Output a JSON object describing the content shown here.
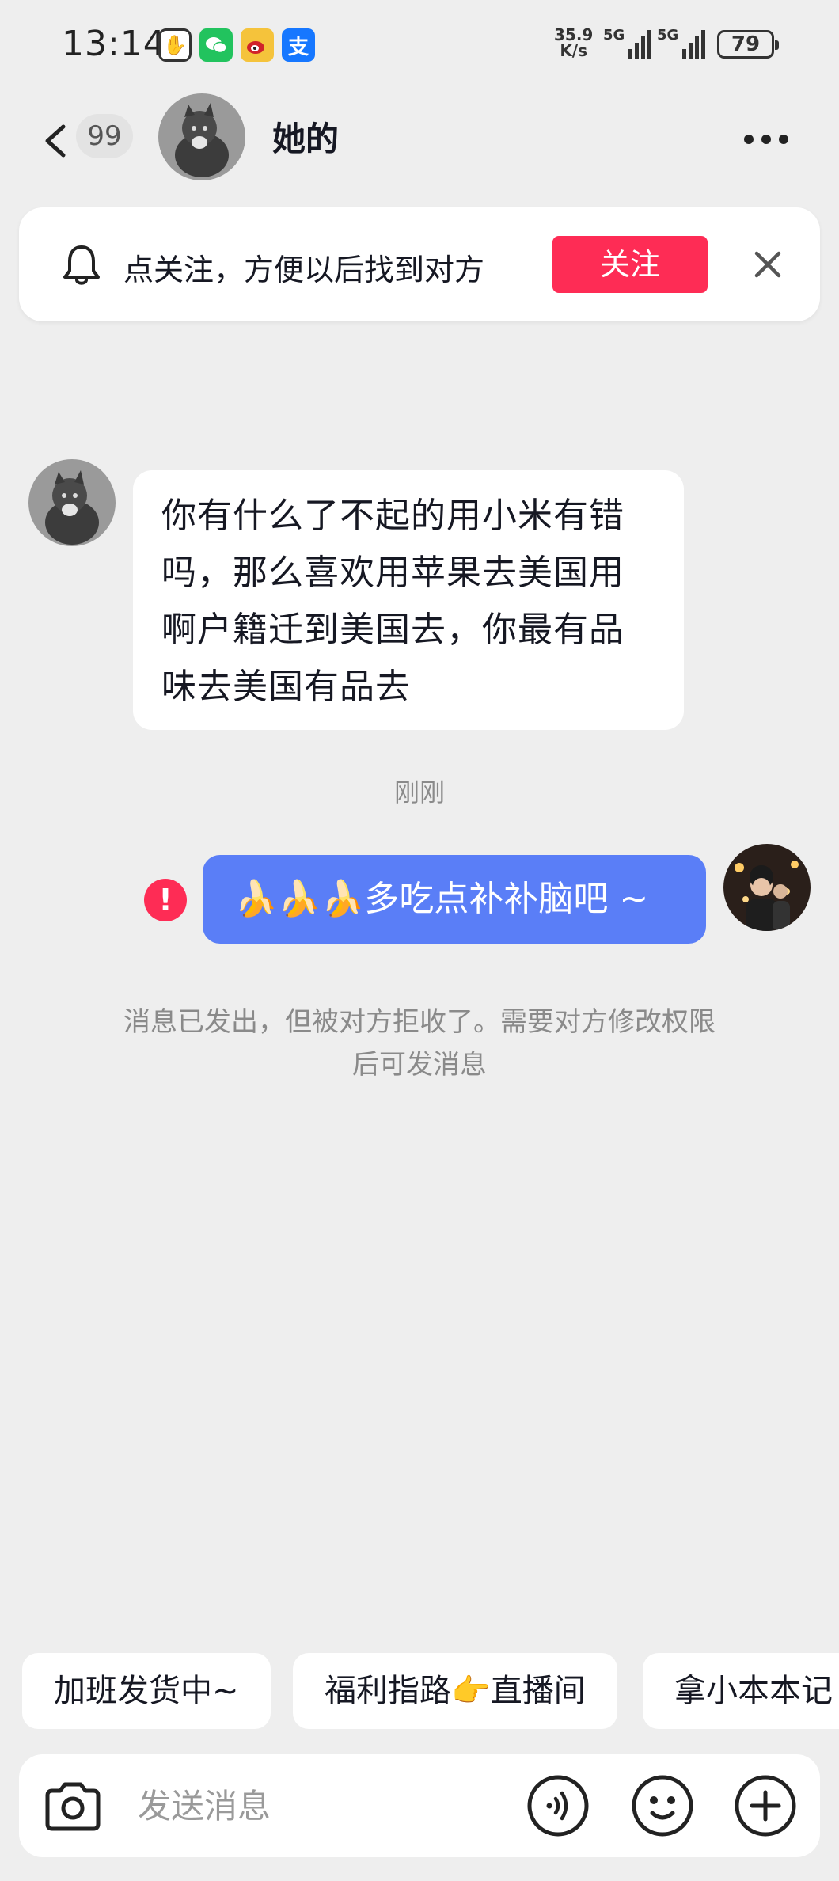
{
  "status_bar": {
    "time": "13:14",
    "net_speed_value": "35.9",
    "net_speed_unit": "K/s",
    "signal1_label": "5G",
    "signal2_label": "5G",
    "battery": "79"
  },
  "header": {
    "unread_count": "99",
    "title": "她的"
  },
  "follow_banner": {
    "text": "点关注，方便以后找到对方",
    "button_label": "关注"
  },
  "messages": {
    "incoming_text": "你有什么了不起的用小米有错吗，那么喜欢用苹果去美国用啊户籍迁到美国去，你最有品味去美国有品去",
    "timestamp": "刚刚",
    "outgoing_text": "🍌🍌🍌多吃点补补脑吧 ~",
    "failed_icon_glyph": "!",
    "system_notice": "消息已发出，但被对方拒收了。需要对方修改权限后可发消息"
  },
  "quick_replies": [
    {
      "label": "加班发货中~"
    },
    {
      "label": "福利指路👉直播间"
    },
    {
      "label": "拿小本本记"
    }
  ],
  "input": {
    "placeholder": "发送消息",
    "value": ""
  },
  "colors": {
    "accent_red": "#fe2c55",
    "bubble_blue": "#5a7ef7",
    "background": "#eeeeee"
  },
  "icons": [
    "back-arrow-icon",
    "bell-icon",
    "close-icon",
    "more-icon",
    "camera-icon",
    "voice-icon",
    "emoji-icon",
    "plus-icon",
    "error-icon"
  ]
}
